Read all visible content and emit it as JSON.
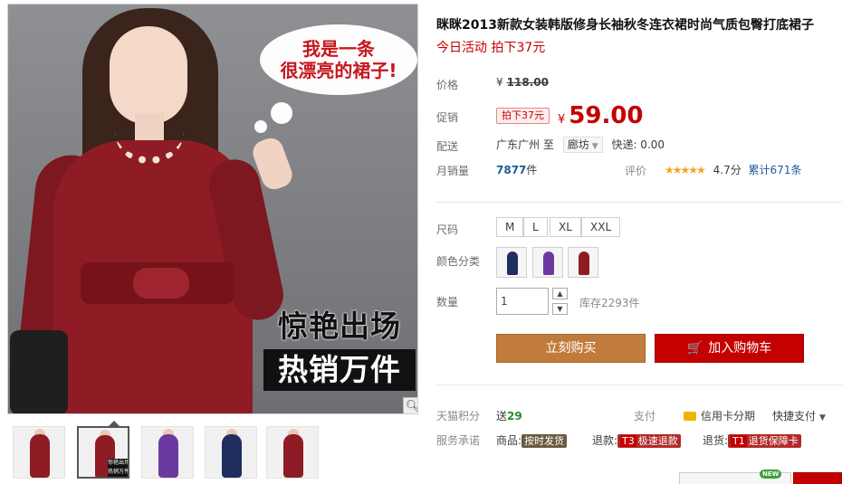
{
  "gallery": {
    "bubble_line1": "我是一条",
    "bubble_line2": "很漂亮的裙子!",
    "slogan_line1": "惊艳出场",
    "slogan_line2": "热销万件",
    "zoom_icon": "magnifier-icon",
    "thumb_caption": "惊艳出场 热销万件",
    "thumb_colors": [
      "#8f1c25",
      "#8f1c25",
      "#6b3aa0",
      "#1f2e5c",
      "#8f1c25"
    ]
  },
  "product": {
    "title": "眯眯2013新款女装韩版修身长袖秋冬连衣裙时尚气质包臀打底裙子",
    "promo_line": "今日活动 拍下37元"
  },
  "price": {
    "label": "价格",
    "currency": "¥",
    "original": "118.00",
    "promo_label": "促销",
    "promo_tag": "拍下37元",
    "sale": "59.00"
  },
  "shipping": {
    "label": "配送",
    "from": "广东广州",
    "to_word": "至",
    "destination": "廊坊",
    "fee": "快递: 0.00"
  },
  "sales": {
    "label": "月销量",
    "count": "7877",
    "unit": "件",
    "rating_label": "评价",
    "stars": "★★★★★",
    "score": "4.7分",
    "reviews": "累计671条"
  },
  "options": {
    "size_label": "尺码",
    "sizes": [
      "M",
      "L",
      "XL",
      "XXL"
    ],
    "color_label": "颜色分类",
    "colors": [
      "#1f2e5c",
      "#6b3aa0",
      "#8f1c25"
    ],
    "qty_label": "数量",
    "qty_value": "1",
    "up_icon": "▲",
    "down_icon": "▼",
    "stock": "库存2293件"
  },
  "actions": {
    "buy": "立刻购买",
    "cart": "加入购物车",
    "cart_icon": "🛒"
  },
  "services": {
    "points_label": "天猫积分",
    "points_prefix": "送",
    "points": "29",
    "pay_label": "支付",
    "credit": "信用卡分期",
    "quickpay": "快捷支付",
    "promise_label": "服务承诺",
    "goods_label": "商品:",
    "goods_badge": "按时发货",
    "refund_label": "退款:",
    "refund_code": "T3",
    "refund_badge": "极速退款",
    "return_label": "退货:",
    "return_code": "T1",
    "return_badge": "退货保障卡",
    "new_tag": "NEW"
  }
}
